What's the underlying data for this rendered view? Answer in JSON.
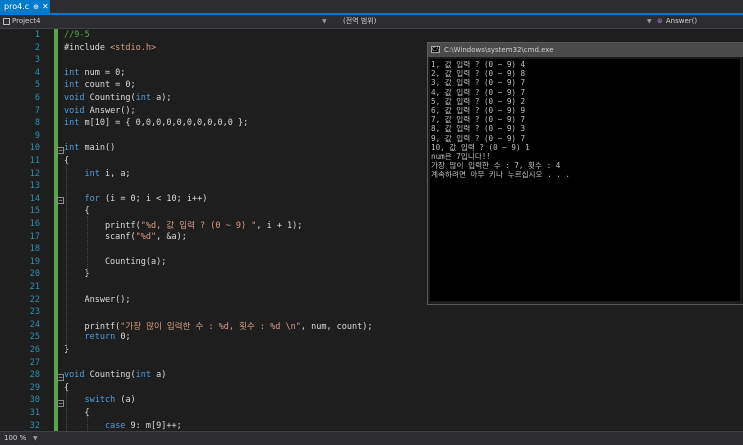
{
  "tab": {
    "label": "pro4.c",
    "pin": "⊕",
    "close": "✕"
  },
  "nav": {
    "project": "Project4",
    "scope": "(전역 범위)",
    "member": "Answer()",
    "project_icon": "project-icon",
    "member_icon": "method-icon"
  },
  "lines": [
    {
      "n": "1",
      "t": "//9-5"
    },
    {
      "n": "2",
      "t": "#include <stdio.h>"
    },
    {
      "n": "3",
      "t": ""
    },
    {
      "n": "4",
      "t": "int num = 0;"
    },
    {
      "n": "5",
      "t": "int count = 0;"
    },
    {
      "n": "6",
      "t": "void Counting(int a);"
    },
    {
      "n": "7",
      "t": "void Answer();"
    },
    {
      "n": "8",
      "t": "int m[10] = { 0,0,0,0,0,0,0,0,0,0 };"
    },
    {
      "n": "9",
      "t": ""
    },
    {
      "n": "10",
      "t": "int main()"
    },
    {
      "n": "11",
      "t": "{"
    },
    {
      "n": "12",
      "t": "    int i, a;"
    },
    {
      "n": "13",
      "t": ""
    },
    {
      "n": "14",
      "t": "    for (i = 0; i < 10; i++)"
    },
    {
      "n": "15",
      "t": "    {"
    },
    {
      "n": "16",
      "t": "        printf(\"%d, 값 입력 ? (0 ~ 9) \", i + 1);"
    },
    {
      "n": "17",
      "t": "        scanf(\"%d\", &a);"
    },
    {
      "n": "18",
      "t": ""
    },
    {
      "n": "19",
      "t": "        Counting(a);"
    },
    {
      "n": "20",
      "t": "    }"
    },
    {
      "n": "21",
      "t": ""
    },
    {
      "n": "22",
      "t": "    Answer();"
    },
    {
      "n": "23",
      "t": ""
    },
    {
      "n": "24",
      "t": "    printf(\"가장 많이 입력한 수 : %d, 횟수 : %d \\n\", num, count);"
    },
    {
      "n": "25",
      "t": "    return 0;"
    },
    {
      "n": "26",
      "t": "}"
    },
    {
      "n": "27",
      "t": ""
    },
    {
      "n": "28",
      "t": "void Counting(int a)"
    },
    {
      "n": "29",
      "t": "{"
    },
    {
      "n": "30",
      "t": "    switch (a)"
    },
    {
      "n": "31",
      "t": "    {"
    },
    {
      "n": "32",
      "t": "        case 9: m[9]++;"
    }
  ],
  "console": {
    "title": "C:\\Windows\\system32\\cmd.exe",
    "icon": "cmd-icon",
    "lines": [
      "1, 값 입력 ? (0 ~ 9) 4",
      "2, 값 입력 ? (0 ~ 9) 8",
      "3, 값 입력 ? (0 ~ 9) 7",
      "4, 값 입력 ? (0 ~ 9) 7",
      "5, 값 입력 ? (0 ~ 9) 2",
      "6, 값 입력 ? (0 ~ 9) 9",
      "7, 값 입력 ? (0 ~ 9) 7",
      "8, 값 입력 ? (0 ~ 9) 3",
      "9, 값 입력 ? (0 ~ 9) 7",
      "10, 값 입력 ? (0 ~ 9) 1",
      "num은 7입니다!!",
      "가장 많이 입력한 수 : 7, 횟수 : 4",
      "계속하려면 아무 키나 누르십시오 . . ."
    ]
  },
  "status": {
    "zoom": "100 %"
  },
  "colors": {
    "accent": "#007acc",
    "keyword": "#569cd6",
    "string": "#d69d85",
    "comment": "#57a64a",
    "line_number": "#2b91af"
  }
}
